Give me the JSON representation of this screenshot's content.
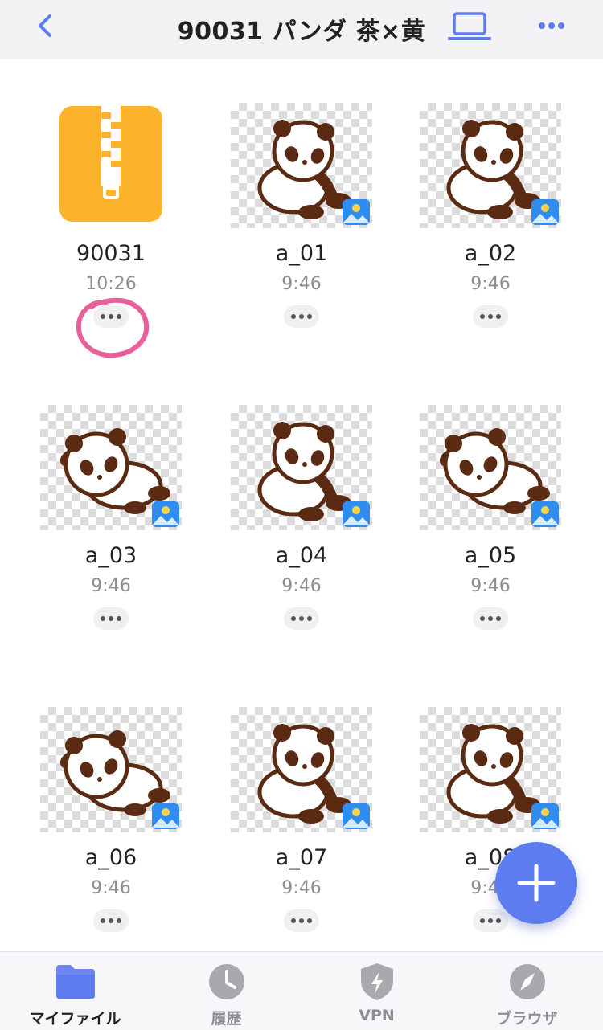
{
  "header": {
    "title": "90031 パンダ 茶×黄",
    "back_icon": "chevron-left-icon",
    "device_icon": "laptop-icon",
    "more_icon": "more-horizontal-icon"
  },
  "files": [
    {
      "name": "90031",
      "time": "10:26",
      "type": "zip-archive",
      "icon": "zip-icon"
    },
    {
      "name": "a_01",
      "time": "9:46",
      "type": "image",
      "icon": "image-badge-icon"
    },
    {
      "name": "a_02",
      "time": "9:46",
      "type": "image",
      "icon": "image-badge-icon"
    },
    {
      "name": "a_03",
      "time": "9:46",
      "type": "image",
      "icon": "image-badge-icon"
    },
    {
      "name": "a_04",
      "time": "9:46",
      "type": "image",
      "icon": "image-badge-icon"
    },
    {
      "name": "a_05",
      "time": "9:46",
      "type": "image",
      "icon": "image-badge-icon"
    },
    {
      "name": "a_06",
      "time": "9:46",
      "type": "image",
      "icon": "image-badge-icon"
    },
    {
      "name": "a_07",
      "time": "9:46",
      "type": "image",
      "icon": "image-badge-icon"
    },
    {
      "name": "a_08",
      "time": "9:46",
      "type": "image",
      "icon": "image-badge-icon"
    }
  ],
  "fab": {
    "icon": "plus-icon"
  },
  "tabs": [
    {
      "label": "マイファイル",
      "icon": "folder-icon",
      "active": true
    },
    {
      "label": "履歴",
      "icon": "clock-icon",
      "active": false
    },
    {
      "label": "VPN",
      "icon": "shield-bolt-icon",
      "active": false
    },
    {
      "label": "ブラウザ",
      "icon": "compass-icon",
      "active": false
    }
  ],
  "colors": {
    "accent": "#5d7cf0",
    "zip": "#fbb32c",
    "annotation": "#e8609a",
    "panda_dark": "#5a2a12"
  }
}
